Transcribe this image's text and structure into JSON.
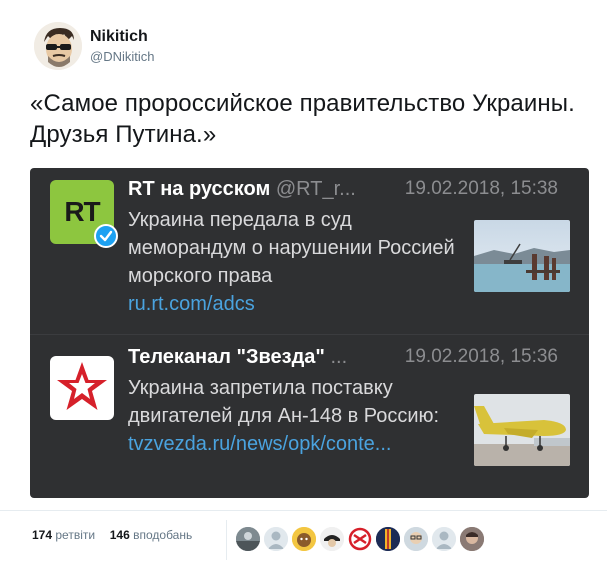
{
  "author": {
    "display_name": "Nikitich",
    "handle": "@DNikitich"
  },
  "tweet": {
    "text": "«Самое пророссийское правительство Украины. Друзья Путина.»"
  },
  "embedded": [
    {
      "logo_text": "RT",
      "account": "RT на русском",
      "handle": "@RT_r...",
      "date": "19.02.2018, 15:38",
      "text": "Украина передала в суд меморандум о нарушении Россией морского права",
      "link": "ru.rt.com/adcs",
      "thumb_icon": "construction-at-sea-photo"
    },
    {
      "logo_text": "",
      "account": "Телеканал \"Звезда\"",
      "handle": "...",
      "date": "19.02.2018, 15:36",
      "text": "Украина запретила поставку двигателей для Ан-148 в Россию:",
      "link": "tvzvezda.ru/news/opk/conte...",
      "thumb_icon": "yellow-airplane-photo"
    }
  ],
  "stats": {
    "retweets_count": "174",
    "retweets_label": "ретвіти",
    "likes_count": "146",
    "likes_label": "вподобань"
  },
  "colors": {
    "rt_green": "#8dc63f",
    "link_blue": "#4aa3df",
    "card_bg": "#2f3032",
    "verified_blue": "#1da1f2"
  }
}
